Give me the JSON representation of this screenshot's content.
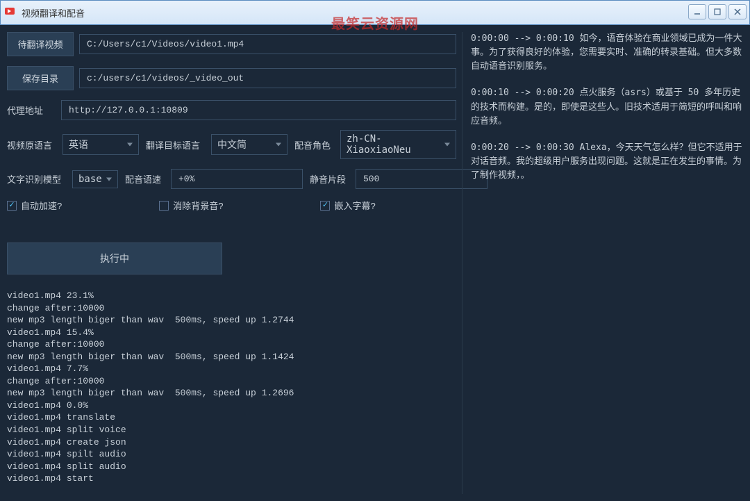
{
  "watermark": "最笑云资源网",
  "window": {
    "title": "视频翻译和配音"
  },
  "labels": {
    "video_to_translate": "待翻译视频",
    "save_dir": "保存目录",
    "proxy": "代理地址",
    "source_lang": "视频原语言",
    "target_lang": "翻译目标语言",
    "voice_role": "配音角色",
    "recognition_model": "文字识别模型",
    "voice_speed": "配音语速",
    "silence_segment": "静音片段",
    "auto_speed": "自动加速?",
    "remove_bg_sound": "消除背景音?",
    "embed_subs": "嵌入字幕?",
    "executing": "执行中"
  },
  "values": {
    "video_path": "C:/Users/c1/Videos/video1.mp4",
    "save_dir": "c:/users/c1/videos/_video_out",
    "proxy": "http://127.0.0.1:10809",
    "source_lang": "英语",
    "target_lang": "中文简",
    "voice_role": "zh-CN-XiaoxiaoNeu",
    "recognition_model": "base",
    "voice_speed": "+0%",
    "silence_segment": "500",
    "auto_speed_checked": true,
    "remove_bg_checked": false,
    "embed_subs_checked": true
  },
  "log": "video1.mp4 23.1%\nchange after:10000\nnew mp3 length biger than wav  500ms, speed up 1.2744\nvideo1.mp4 15.4%\nchange after:10000\nnew mp3 length biger than wav  500ms, speed up 1.1424\nvideo1.mp4 7.7%\nchange after:10000\nnew mp3 length biger than wav  500ms, speed up 1.2696\nvideo1.mp4 0.0%\nvideo1.mp4 translate\nvideo1.mp4 split voice\nvideo1.mp4 create json\nvideo1.mp4 spilt audio\nvideo1.mp4 split audio\nvideo1.mp4 start",
  "transcript": {
    "block1": "0:00:00 --> 0:00:10 如今，语音体验在商业领域已成为一件大事。为了获得良好的体验，您需要实时、准确的转录基础。但大多数自动语音识别服务。",
    "block2": "0:00:10 --> 0:00:20 点火服务（asrs）或基于 50 多年历史的技术而构建。是的，即使是这些人。旧技术适用于简短的呼叫和响应音频。",
    "block3": "0:00:20 --> 0:00:30 Alexa，今天天气怎么样？但它不适用于对话音频。我的超级用户服务出现问题。这就是正在发生的事情。为了制作视频，。"
  }
}
